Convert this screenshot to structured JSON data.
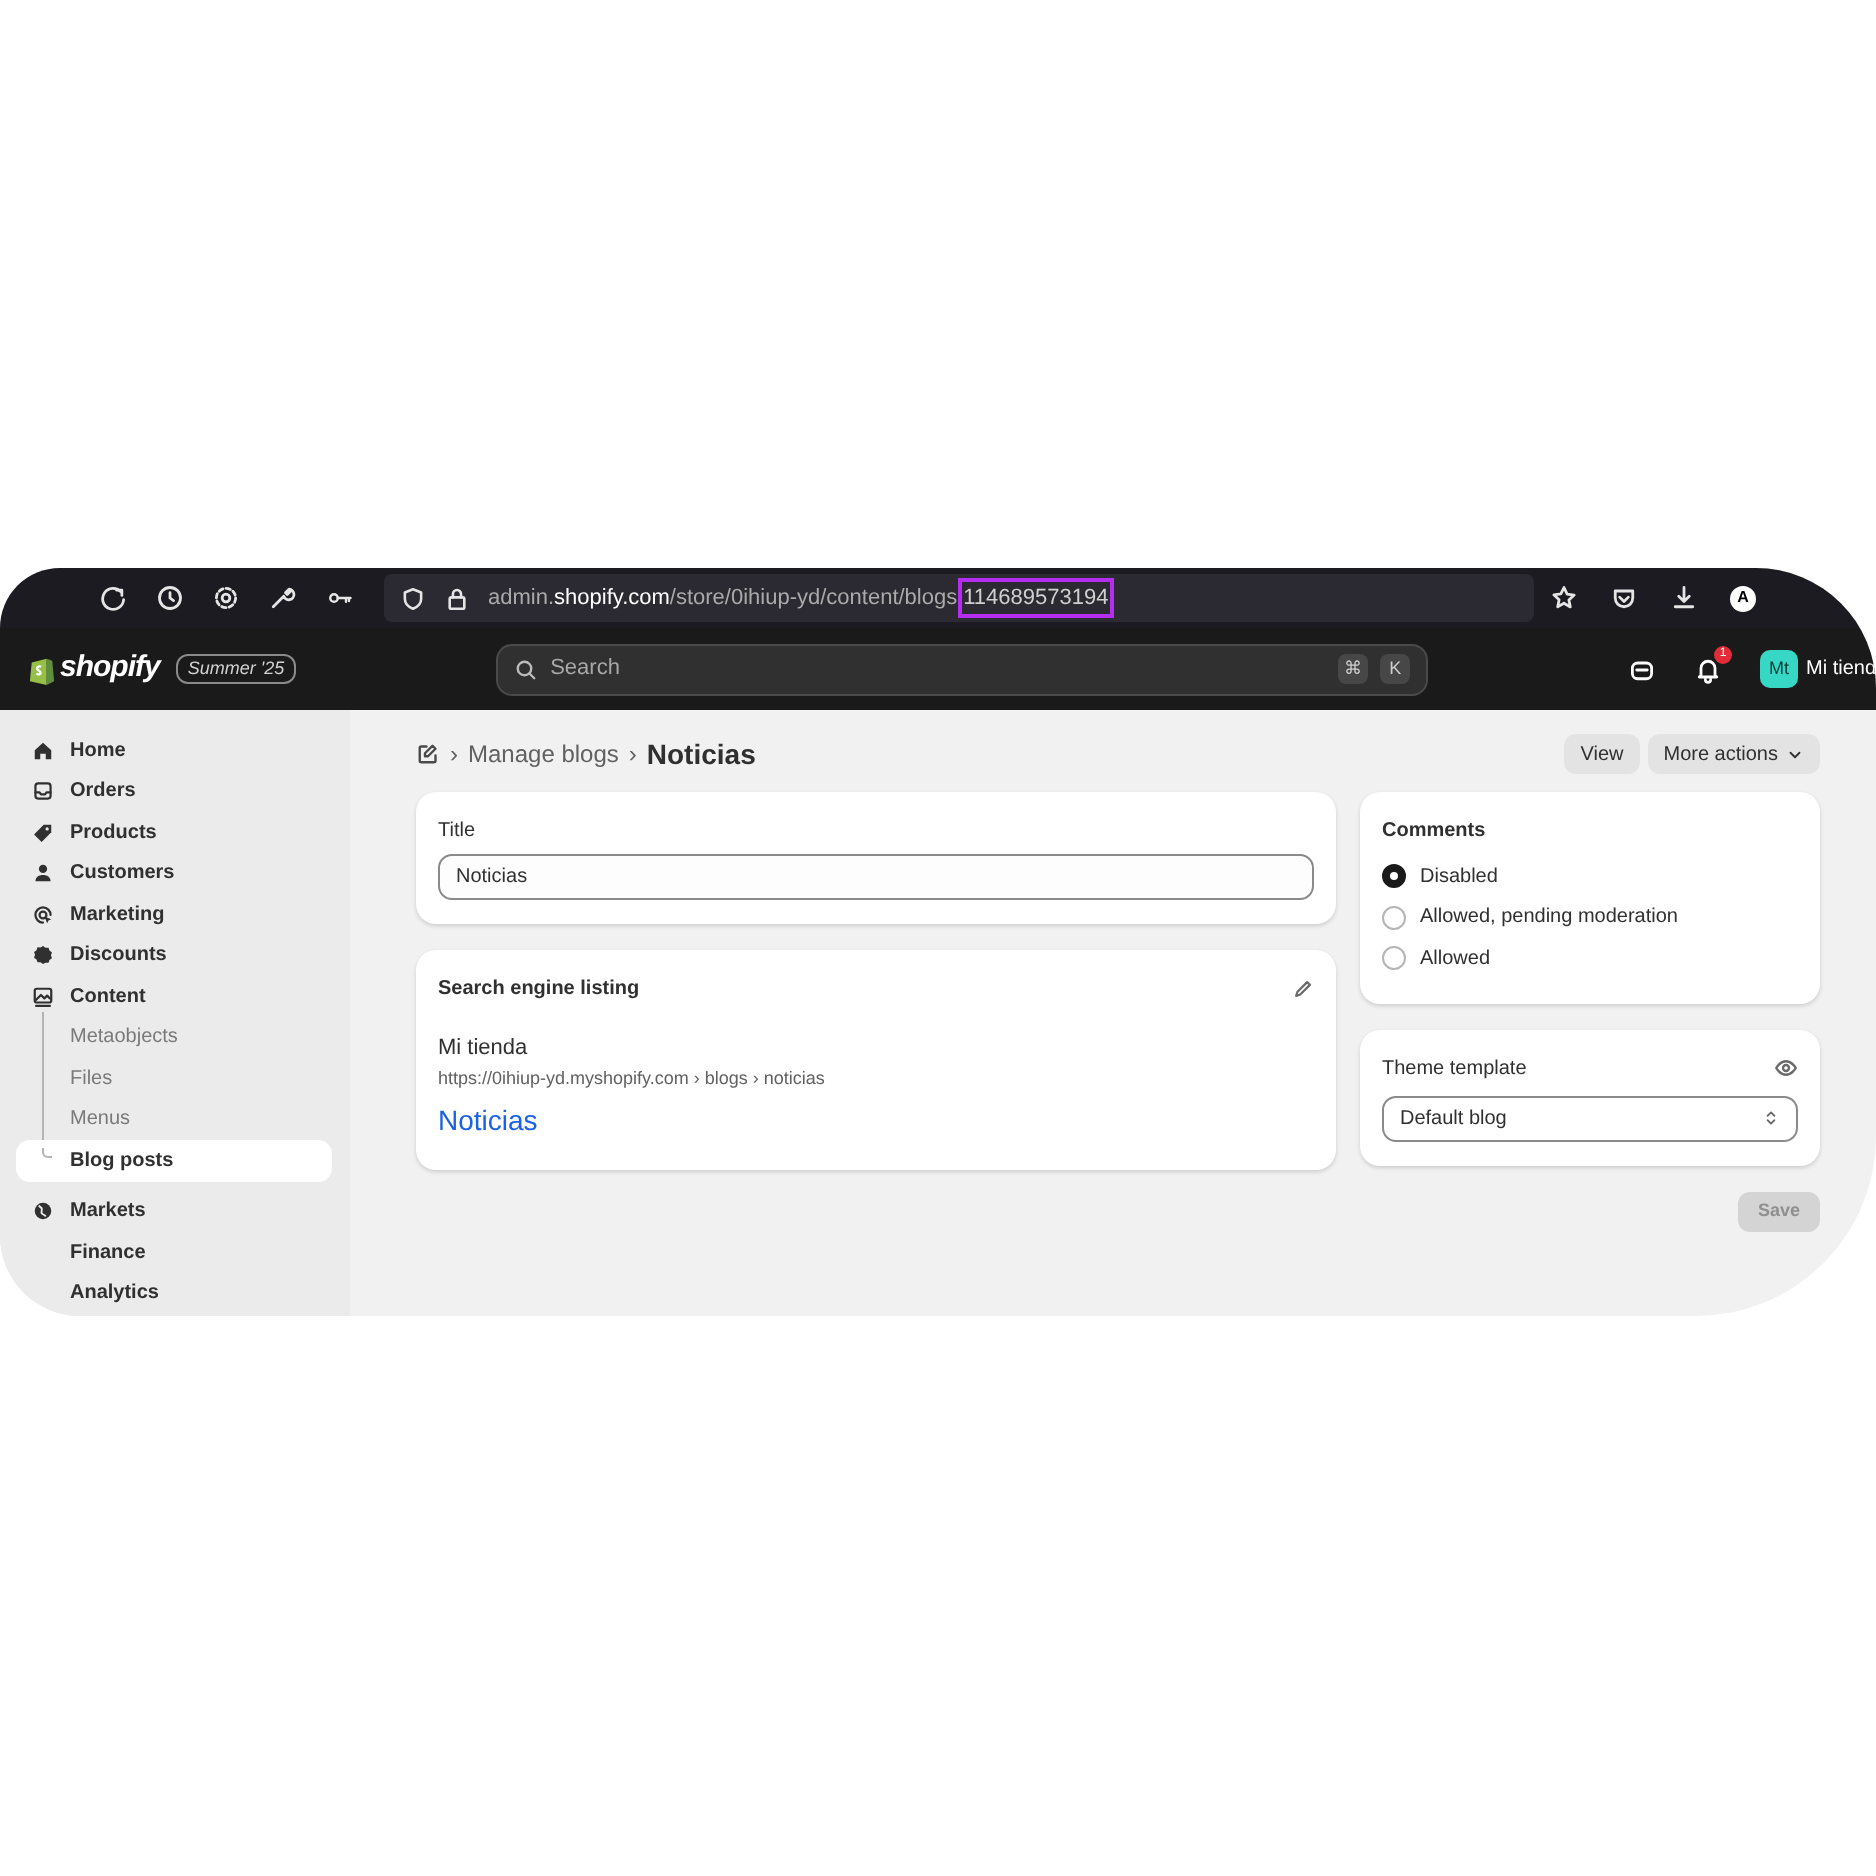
{
  "browser": {
    "url_host_prefix": "admin.",
    "url_host": "shopify.com",
    "url_path": "/store/0ihiup-yd/content/blogs",
    "url_highlight": "114689573194",
    "profile_initial": "A"
  },
  "topbar": {
    "logo": "shopify",
    "edition": "Summer '25",
    "search_placeholder": "Search",
    "shortcut_keys": [
      "⌘",
      "K"
    ],
    "notifications": "1",
    "store_initials": "Mt",
    "store_name": "Mi tiend"
  },
  "sidebar": {
    "items": [
      {
        "label": "Home",
        "selected": false
      },
      {
        "label": "Orders",
        "selected": false
      },
      {
        "label": "Products",
        "selected": false
      },
      {
        "label": "Customers",
        "selected": false
      },
      {
        "label": "Marketing",
        "selected": false
      },
      {
        "label": "Discounts",
        "selected": false
      },
      {
        "label": "Content",
        "selected": false,
        "children": [
          {
            "label": "Metaobjects",
            "selected": false
          },
          {
            "label": "Files",
            "selected": false
          },
          {
            "label": "Menus",
            "selected": false
          },
          {
            "label": "Blog posts",
            "selected": true
          }
        ]
      },
      {
        "label": "Markets",
        "selected": false
      },
      {
        "label": "Finance",
        "selected": false
      },
      {
        "label": "Analytics",
        "selected": false
      }
    ]
  },
  "breadcrumb": {
    "separators": [
      "›",
      "›"
    ],
    "parent": "Manage blogs",
    "current": "Noticias"
  },
  "actions": [
    {
      "label": "View",
      "kind": "plain"
    },
    {
      "label": "More actions",
      "kind": "menu"
    }
  ],
  "title_card": {
    "label": "Title",
    "value": "Noticias"
  },
  "seo_card": {
    "heading": "Search engine listing",
    "store": "Mi tienda",
    "url": "https://0ihiup-yd.myshopify.com › blogs › noticias",
    "link_title": "Noticias"
  },
  "comments": {
    "heading": "Comments",
    "options": [
      {
        "label": "Disabled",
        "selected": true
      },
      {
        "label": "Allowed, pending moderation",
        "selected": false
      },
      {
        "label": "Allowed",
        "selected": false
      }
    ]
  },
  "theme_template": {
    "heading": "Theme template",
    "value": "Default blog"
  },
  "save": {
    "label": "Save",
    "disabled": true
  }
}
